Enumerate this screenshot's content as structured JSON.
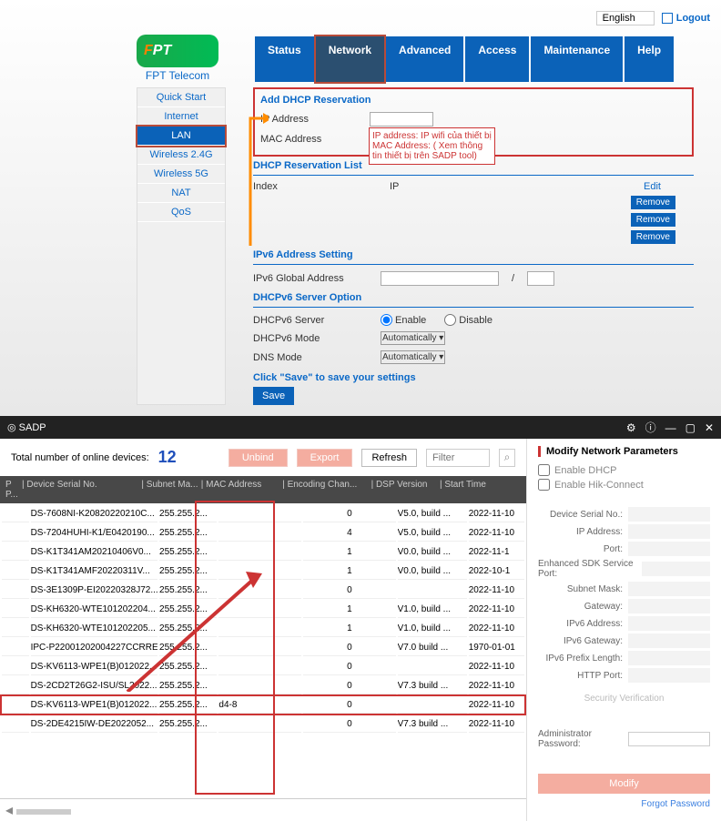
{
  "router": {
    "lang": "English",
    "logout": "Logout",
    "brand_1": "F",
    "brand_2": "P",
    "brand_3": "T",
    "brand_sub": "FPT Telecom",
    "nav": [
      "Status",
      "Network",
      "Advanced",
      "Access",
      "Maintenance",
      "Help"
    ],
    "side": [
      "Quick Start",
      "Internet",
      "LAN",
      "Wireless 2.4G",
      "Wireless 5G",
      "NAT",
      "QoS"
    ],
    "sect_add": "Add DHCP Reservation",
    "lbl_ip": "IP Address",
    "lbl_mac": "MAC Address",
    "sect_list": "DHCP Reservation List",
    "th_index": "Index",
    "th_ip": "IP",
    "th_edit": "Edit",
    "remove": "Remove",
    "note1": "IP address: IP wifi của thiết bị",
    "note2": "MAC Address: ( Xem thông",
    "note3": "tin thiết bị trên SADP tool)",
    "sect_v6": "IPv6 Address Setting",
    "lbl_v6g": "IPv6 Global Address",
    "sect_d6": "DHCPv6 Server Option",
    "lbl_d6s": "DHCPv6 Server",
    "opt_en": "Enable",
    "opt_dis": "Disable",
    "lbl_d6m": "DHCPv6 Mode",
    "sel_auto": "Automatically ▾",
    "lbl_dns": "DNS Mode",
    "savehint": "Click \"Save\" to save your settings",
    "save": "Save"
  },
  "sadp": {
    "title": "SADP",
    "total_lbl": "Total number of online devices:",
    "total": "12",
    "unbind": "Unbind",
    "export": "Export",
    "refresh": "Refresh",
    "filter_ph": "Filter",
    "cols": {
      "pp": "P P...",
      "serial": "Device Serial No.",
      "sub": "Subnet Ma...",
      "mac": "MAC Address",
      "enc": "Encoding Chan...",
      "dsp": "DSP Version",
      "start": "Start Time"
    },
    "rows": [
      {
        "s": "DS-7608NI-K20820220210C...",
        "m": "255.255.2...",
        "mac": "",
        "e": "0",
        "d": "V5.0, build ...",
        "t": "2022-11-10"
      },
      {
        "s": "DS-7204HUHI-K1/E0420190...",
        "m": "255.255.2...",
        "mac": "",
        "e": "4",
        "d": "V5.0, build ...",
        "t": "2022-11-10"
      },
      {
        "s": "DS-K1T341AM20210406V0...",
        "m": "255.255.2...",
        "mac": "",
        "e": "1",
        "d": "V0.0, build ...",
        "t": "2022-11-1"
      },
      {
        "s": "DS-K1T341AMF20220311V...",
        "m": "255.255.2...",
        "mac": "",
        "e": "1",
        "d": "V0.0, build ...",
        "t": "2022-10-1"
      },
      {
        "s": "DS-3E1309P-EI20220328J72...",
        "m": "255.255.2...",
        "mac": "",
        "e": "0",
        "d": "",
        "t": "2022-11-10"
      },
      {
        "s": "DS-KH6320-WTE101202204...",
        "m": "255.255.2...",
        "mac": "",
        "e": "1",
        "d": "V1.0, build ...",
        "t": "2022-11-10"
      },
      {
        "s": "DS-KH6320-WTE101202205...",
        "m": "255.255.2...",
        "mac": "",
        "e": "1",
        "d": "V1.0, build ...",
        "t": "2022-11-10"
      },
      {
        "s": "IPC-P22001202004227CCRRE...",
        "m": "255.255.2...",
        "mac": "",
        "e": "0",
        "d": "V7.0 build ...",
        "t": "1970-01-01"
      },
      {
        "s": "DS-KV6113-WPE1(B)012022...",
        "m": "255.255.2...",
        "mac": "",
        "e": "0",
        "d": "",
        "t": "2022-11-10"
      },
      {
        "s": "DS-2CD2T26G2-ISU/SL2022...",
        "m": "255.255.2...",
        "mac": "",
        "e": "0",
        "d": "V7.3 build ...",
        "t": "2022-11-10"
      },
      {
        "s": "DS-KV6113-WPE1(B)012022...",
        "m": "255.255.2...",
        "mac": "d4-8",
        "e": "0",
        "d": "",
        "t": "2022-11-10"
      },
      {
        "s": "DS-2DE4215IW-DE2022052...",
        "m": "255.255.2...",
        "mac": "",
        "e": "0",
        "d": "V7.3 build ...",
        "t": "2022-11-10"
      }
    ],
    "panel": {
      "title": "Modify Network Parameters",
      "en_dhcp": "Enable DHCP",
      "en_hik": "Enable Hik-Connect",
      "f": [
        "Device Serial No.:",
        "IP Address:",
        "Port:",
        "Enhanced SDK Service Port:",
        "Subnet Mask:",
        "Gateway:",
        "IPv6 Address:",
        "IPv6 Gateway:",
        "IPv6 Prefix Length:",
        "HTTP Port:"
      ],
      "sec": "Security Verification",
      "admin": "Administrator Password:",
      "modify": "Modify",
      "forgot": "Forgot Password"
    }
  }
}
